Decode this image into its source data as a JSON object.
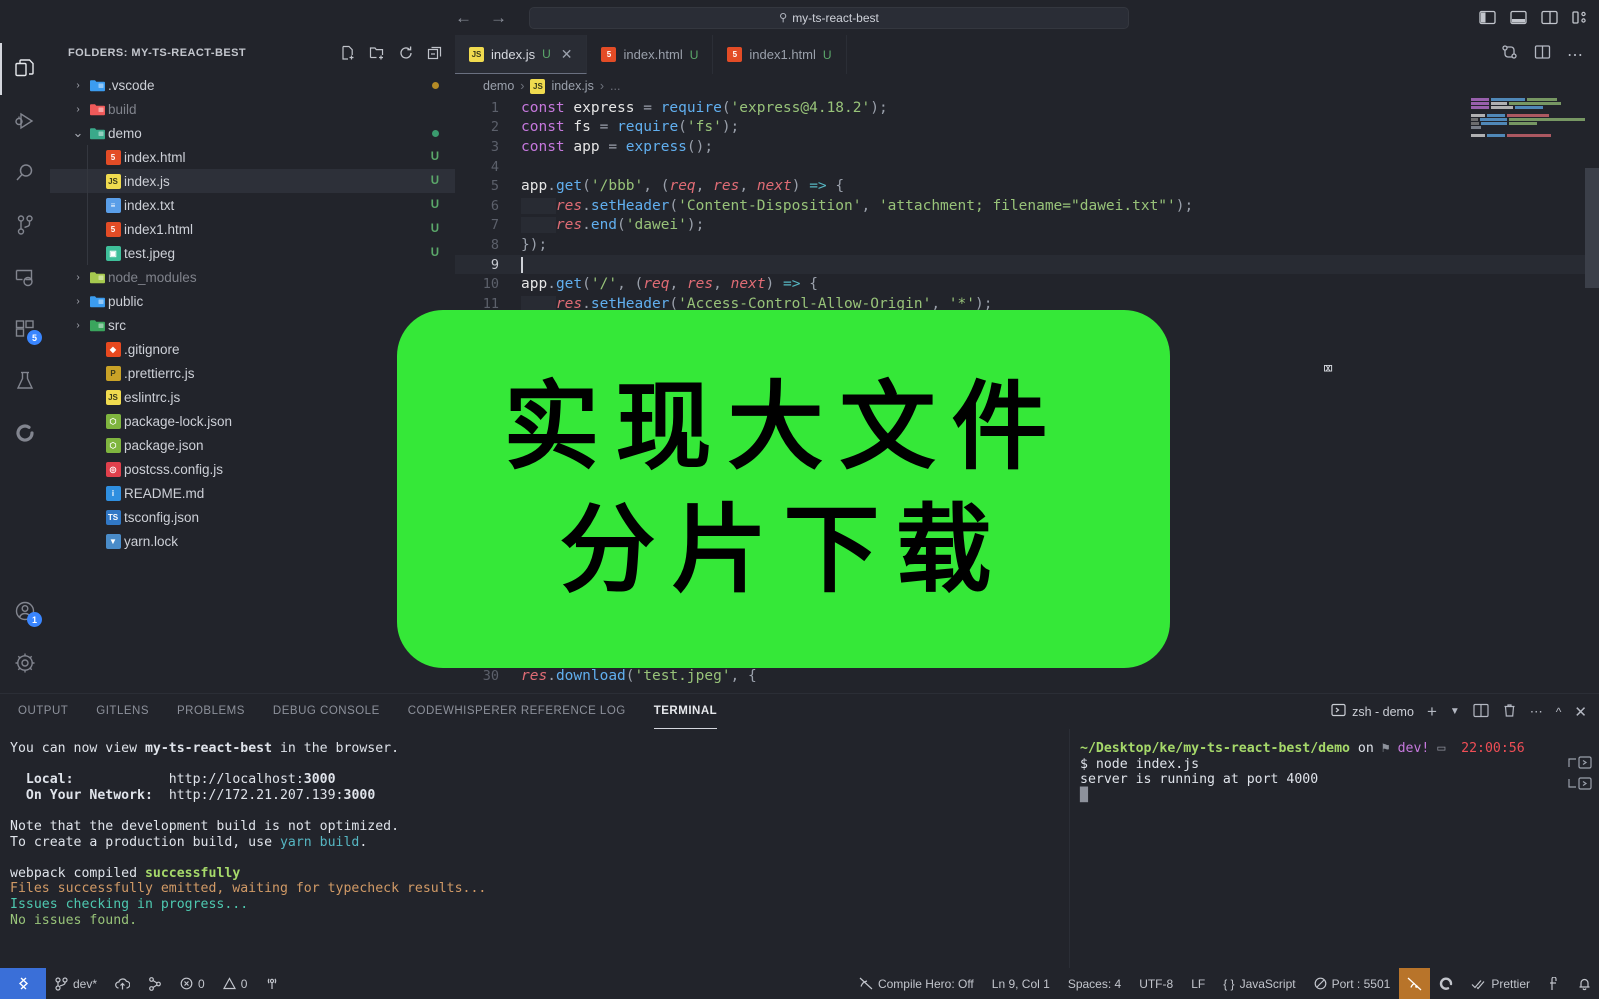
{
  "titlebar": {
    "back_icon": "arrow-left-icon",
    "forward_icon": "arrow-right-icon",
    "search_value": "my-ts-react-best",
    "search_icon": "search-icon",
    "layout_icons": [
      "toggle-primary-sidebar-icon",
      "toggle-panel-icon",
      "toggle-secondary-sidebar-icon",
      "customize-layout-icon"
    ]
  },
  "activitybar": {
    "items": [
      {
        "name": "explorer",
        "icon": "files-icon",
        "active": true
      },
      {
        "name": "run-and-debug",
        "icon": "debug-icon",
        "active": false
      },
      {
        "name": "search",
        "icon": "search-icon",
        "active": false
      },
      {
        "name": "source-control",
        "icon": "source-control-icon",
        "active": false
      },
      {
        "name": "remote-explorer",
        "icon": "remote-explorer-icon",
        "active": false
      },
      {
        "name": "extensions",
        "icon": "extensions-icon",
        "active": false,
        "badge": "5"
      },
      {
        "name": "testing",
        "icon": "beaker-icon",
        "active": false
      },
      {
        "name": "codewhisperer",
        "icon": "codewhisperer-icon",
        "active": false
      }
    ],
    "bottom": [
      {
        "name": "accounts",
        "icon": "account-icon",
        "badge": "1"
      },
      {
        "name": "manage",
        "icon": "gear-icon"
      }
    ]
  },
  "sidebar": {
    "title": "FOLDERS: MY-TS-REACT-BEST",
    "actions": [
      "new-file-icon",
      "new-folder-icon",
      "refresh-icon",
      "collapse-all-icon"
    ],
    "tree": [
      {
        "label": ".vscode",
        "type": "folder",
        "expanded": false,
        "indent": 0,
        "icon_color": "#3b9cf0",
        "badge": "",
        "dot": "#b58b26",
        "dim": false
      },
      {
        "label": "build",
        "type": "folder",
        "expanded": false,
        "indent": 0,
        "icon_color": "#ef5a5a",
        "badge": "",
        "dot": "",
        "dim": true
      },
      {
        "label": "demo",
        "type": "folder",
        "expanded": true,
        "indent": 0,
        "icon_color": "#3aa98a",
        "badge": "",
        "dot": "#3a9b6e",
        "dim": false
      },
      {
        "label": "index.html",
        "type": "html",
        "expanded": false,
        "indent": 1,
        "icon_color": "#e34c26",
        "badge": "U",
        "dot": "",
        "dim": false
      },
      {
        "label": "index.js",
        "type": "js",
        "expanded": false,
        "indent": 1,
        "icon_color": "#f0db4f",
        "badge": "U",
        "dot": "",
        "dim": false,
        "selected": true
      },
      {
        "label": "index.txt",
        "type": "txt",
        "expanded": false,
        "indent": 1,
        "icon_color": "#5a9ee8",
        "badge": "U",
        "dot": "",
        "dim": false
      },
      {
        "label": "index1.html",
        "type": "html",
        "expanded": false,
        "indent": 1,
        "icon_color": "#e34c26",
        "badge": "U",
        "dot": "",
        "dim": false
      },
      {
        "label": "test.jpeg",
        "type": "img",
        "expanded": false,
        "indent": 1,
        "icon_color": "#3fbf9a",
        "badge": "U",
        "dot": "",
        "dim": false
      },
      {
        "label": "node_modules",
        "type": "folder",
        "expanded": false,
        "indent": 0,
        "icon_color": "#a6c94f",
        "badge": "",
        "dot": "",
        "dim": true
      },
      {
        "label": "public",
        "type": "folder",
        "expanded": false,
        "indent": 0,
        "icon_color": "#3b9cf0",
        "badge": "",
        "dot": "",
        "dim": false
      },
      {
        "label": "src",
        "type": "folder",
        "expanded": false,
        "indent": 0,
        "icon_color": "#3aa55d",
        "badge": "",
        "dot": "",
        "dim": false
      },
      {
        "label": ".gitignore",
        "type": "git",
        "expanded": false,
        "indent": 1,
        "icon_color": "#e8491f",
        "badge": "",
        "dot": "",
        "dim": false
      },
      {
        "label": ".prettierrc.js",
        "type": "prettier",
        "expanded": false,
        "indent": 1,
        "icon_color": "#c9a227",
        "badge": "",
        "dot": "",
        "dim": false
      },
      {
        "label": "eslintrc.js",
        "type": "js",
        "expanded": false,
        "indent": 1,
        "icon_color": "#f0db4f",
        "badge": "",
        "dot": "",
        "dim": false
      },
      {
        "label": "package-lock.json",
        "type": "node",
        "expanded": false,
        "indent": 1,
        "icon_color": "#7fb53f",
        "badge": "",
        "dot": "",
        "dim": false
      },
      {
        "label": "package.json",
        "type": "node",
        "expanded": false,
        "indent": 1,
        "icon_color": "#7fb53f",
        "badge": "",
        "dot": "",
        "dim": false
      },
      {
        "label": "postcss.config.js",
        "type": "postcss",
        "expanded": false,
        "indent": 1,
        "icon_color": "#e0404c",
        "badge": "",
        "dot": "",
        "dim": false
      },
      {
        "label": "README.md",
        "type": "info",
        "expanded": false,
        "indent": 1,
        "icon_color": "#2f8fe0",
        "badge": "",
        "dot": "",
        "dim": false
      },
      {
        "label": "tsconfig.json",
        "type": "ts",
        "expanded": false,
        "indent": 1,
        "icon_color": "#3178c6",
        "badge": "",
        "dot": "",
        "dim": false
      },
      {
        "label": "yarn.lock",
        "type": "yarn",
        "expanded": false,
        "indent": 1,
        "icon_color": "#4a8cc9",
        "badge": "",
        "dot": "",
        "dim": false
      }
    ]
  },
  "editor": {
    "tabs": [
      {
        "label": "index.js",
        "icon": "js-file-icon",
        "git": "U",
        "active": true,
        "closable": true
      },
      {
        "label": "index.html",
        "icon": "html-file-icon",
        "git": "U",
        "active": false,
        "closable": false
      },
      {
        "label": "index1.html",
        "icon": "html-file-icon",
        "git": "U",
        "active": false,
        "closable": false
      }
    ],
    "tabs_actions": [
      "split-diff-icon",
      "split-editor-icon",
      "more-actions-icon"
    ],
    "breadcrumb": [
      "demo",
      "index.js",
      "..."
    ],
    "lines": [
      {
        "n": "1",
        "tokens": [
          [
            "t-kw",
            "const"
          ],
          [
            "t-pun",
            " "
          ],
          [
            "t-var",
            "express"
          ],
          [
            "t-pun",
            " = "
          ],
          [
            "t-fn",
            "require"
          ],
          [
            "t-pun",
            "("
          ],
          [
            "t-str",
            "'express@4.18.2'"
          ],
          [
            "t-pun",
            ");"
          ]
        ]
      },
      {
        "n": "2",
        "tokens": [
          [
            "t-kw",
            "const"
          ],
          [
            "t-pun",
            " "
          ],
          [
            "t-var",
            "fs"
          ],
          [
            "t-pun",
            " = "
          ],
          [
            "t-fn",
            "require"
          ],
          [
            "t-pun",
            "("
          ],
          [
            "t-str",
            "'fs'"
          ],
          [
            "t-pun",
            ");"
          ]
        ]
      },
      {
        "n": "3",
        "tokens": [
          [
            "t-kw",
            "const"
          ],
          [
            "t-pun",
            " "
          ],
          [
            "t-var",
            "app"
          ],
          [
            "t-pun",
            " = "
          ],
          [
            "t-fn",
            "express"
          ],
          [
            "t-pun",
            "();"
          ]
        ]
      },
      {
        "n": "4",
        "tokens": []
      },
      {
        "n": "5",
        "tokens": [
          [
            "t-var",
            "app"
          ],
          [
            "t-pun",
            "."
          ],
          [
            "t-fn",
            "get"
          ],
          [
            "t-pun",
            "("
          ],
          [
            "t-str",
            "'/bbb'"
          ],
          [
            "t-pun",
            ", ("
          ],
          [
            "t-par",
            "req"
          ],
          [
            "t-pun",
            ", "
          ],
          [
            "t-par",
            "res"
          ],
          [
            "t-pun",
            ", "
          ],
          [
            "t-par",
            "next"
          ],
          [
            "t-pun",
            ") "
          ],
          [
            "t-op",
            "=>"
          ],
          [
            "t-pun",
            " {"
          ]
        ]
      },
      {
        "n": "6",
        "indent": true,
        "tokens": [
          [
            "t-par",
            "res"
          ],
          [
            "t-pun",
            "."
          ],
          [
            "t-fn",
            "setHeader"
          ],
          [
            "t-pun",
            "("
          ],
          [
            "t-str",
            "'Content-Disposition'"
          ],
          [
            "t-pun",
            ", "
          ],
          [
            "t-str",
            "'attachment; filename=\"dawei.txt\"'"
          ],
          [
            "t-pun",
            ");"
          ]
        ]
      },
      {
        "n": "7",
        "indent": true,
        "tokens": [
          [
            "t-par",
            "res"
          ],
          [
            "t-pun",
            "."
          ],
          [
            "t-fn",
            "end"
          ],
          [
            "t-pun",
            "("
          ],
          [
            "t-str",
            "'dawei'"
          ],
          [
            "t-pun",
            ");"
          ]
        ]
      },
      {
        "n": "8",
        "tokens": [
          [
            "t-pun",
            "});"
          ]
        ]
      },
      {
        "n": "9",
        "current": true,
        "caret": true,
        "tokens": []
      },
      {
        "n": "10",
        "tokens": [
          [
            "t-var",
            "app"
          ],
          [
            "t-pun",
            "."
          ],
          [
            "t-fn",
            "get"
          ],
          [
            "t-pun",
            "("
          ],
          [
            "t-str",
            "'/'"
          ],
          [
            "t-pun",
            ", ("
          ],
          [
            "t-par",
            "req"
          ],
          [
            "t-pun",
            ", "
          ],
          [
            "t-par",
            "res"
          ],
          [
            "t-pun",
            ", "
          ],
          [
            "t-par",
            "next"
          ],
          [
            "t-pun",
            ") "
          ],
          [
            "t-op",
            "=>"
          ],
          [
            "t-pun",
            " {"
          ]
        ]
      },
      {
        "n": "11",
        "indent": true,
        "tokens": [
          [
            "t-par",
            "res"
          ],
          [
            "t-pun",
            "."
          ],
          [
            "t-fn",
            "setHeader"
          ],
          [
            "t-pun",
            "("
          ],
          [
            "t-str",
            "'Access-Control-Allow-Origin'"
          ],
          [
            "t-pun",
            ", "
          ],
          [
            "t-str",
            "'*'"
          ],
          [
            "t-pun",
            ");"
          ]
        ]
      }
    ],
    "obscured_line": {
      "n": "30",
      "tokens": [
        [
          "t-par",
          "res"
        ],
        [
          "t-pun",
          "."
        ],
        [
          "t-fn",
          "download"
        ],
        [
          "t-pun",
          "("
        ],
        [
          "t-str",
          "'test.jpeg'"
        ],
        [
          "t-pun",
          ", {"
        ]
      ]
    },
    "mouse_cursor_icon": "text-ibeam-cursor"
  },
  "overlay": {
    "line1": "实现大文件",
    "line2": "分片下载",
    "background_color": "#35e838",
    "text_color": "#000000"
  },
  "panel": {
    "tabs": [
      {
        "label": "OUTPUT",
        "active": false
      },
      {
        "label": "GITLENS",
        "active": false
      },
      {
        "label": "PROBLEMS",
        "active": false
      },
      {
        "label": "DEBUG CONSOLE",
        "active": false
      },
      {
        "label": "CODEWHISPERER REFERENCE LOG",
        "active": false
      },
      {
        "label": "TERMINAL",
        "active": true
      }
    ],
    "terminal_selector": "zsh - demo",
    "terminal_selector_icon": "terminal-icon",
    "actions": [
      "new-terminal-icon",
      "terminal-dropdown-icon",
      "split-terminal-icon",
      "kill-terminal-icon",
      "panel-more-icon",
      "maximize-panel-icon",
      "close-panel-icon"
    ],
    "left_terminal": [
      {
        "segments": [
          [
            "c-white",
            "You can now view "
          ],
          [
            "c-white bd",
            "my-ts-react-best"
          ],
          [
            "c-white",
            " in the browser."
          ]
        ]
      },
      {
        "segments": []
      },
      {
        "segments": [
          [
            "c-white",
            "  "
          ],
          [
            "c-white bd",
            "Local:"
          ],
          [
            "c-white",
            "            http://localhost:"
          ],
          [
            "c-white bd",
            "3000"
          ]
        ]
      },
      {
        "segments": [
          [
            "c-white",
            "  "
          ],
          [
            "c-white bd",
            "On Your Network:"
          ],
          [
            "c-white",
            "  http://172.21.207.139:"
          ],
          [
            "c-white bd",
            "3000"
          ]
        ]
      },
      {
        "segments": []
      },
      {
        "segments": [
          [
            "c-white",
            "Note that the development build is not optimized."
          ]
        ]
      },
      {
        "segments": [
          [
            "c-white",
            "To create a production build, use "
          ],
          [
            "c-cyan",
            "yarn build"
          ],
          [
            "c-white",
            "."
          ]
        ]
      },
      {
        "segments": []
      },
      {
        "segments": [
          [
            "c-white",
            "webpack compiled "
          ],
          [
            "c-lgreen bd",
            "successfully"
          ]
        ]
      },
      {
        "segments": [
          [
            "c-orange",
            "Files successfully emitted, waiting for typecheck results..."
          ]
        ]
      },
      {
        "segments": [
          [
            "c-teal",
            "Issues checking in progress..."
          ]
        ]
      },
      {
        "segments": [
          [
            "c-green",
            "No issues found."
          ]
        ]
      }
    ],
    "right_terminal": [
      {
        "segments": [
          [
            "c-lgreen bd",
            "~/Desktop/ke/my-ts-react-best/demo"
          ],
          [
            "c-white",
            " on "
          ],
          [
            "c-gray",
            "⚑"
          ],
          [
            "c-magenta",
            " dev!"
          ],
          [
            "c-gray",
            " ▭"
          ],
          [
            "c-red",
            "  22:00:56"
          ]
        ]
      },
      {
        "segments": [
          [
            "c-white",
            "$ node index.js"
          ]
        ]
      },
      {
        "segments": [
          [
            "c-white",
            "server is running at port 4000"
          ]
        ]
      },
      {
        "segments": [
          [
            "c-gray",
            "█"
          ]
        ]
      }
    ],
    "side_buttons": [
      "scroll-to-previous-command-icon",
      "scroll-to-next-command-icon"
    ]
  },
  "statusbar": {
    "remote_icon": "remote-window-icon",
    "left": [
      {
        "name": "branch",
        "icon": "source-control-icon",
        "label": "dev*"
      },
      {
        "name": "sync",
        "icon": "cloud-upload-icon",
        "label": ""
      },
      {
        "name": "gitlens-blame",
        "icon": "gitlens-icon",
        "label": ""
      },
      {
        "name": "errors",
        "icon": "error-icon",
        "label": "0"
      },
      {
        "name": "warnings",
        "icon": "warning-icon",
        "label": "0"
      },
      {
        "name": "ports",
        "icon": "radio-tower-icon",
        "label": ""
      }
    ],
    "right": [
      {
        "name": "compile-hero",
        "icon": "compile-hero-icon",
        "label": "Compile Hero: Off"
      },
      {
        "name": "cursor-position",
        "icon": "",
        "label": "Ln 9, Col 1"
      },
      {
        "name": "indentation",
        "icon": "",
        "label": "Spaces: 4"
      },
      {
        "name": "encoding",
        "icon": "",
        "label": "UTF-8"
      },
      {
        "name": "eol",
        "icon": "",
        "label": "LF"
      },
      {
        "name": "language-mode",
        "icon": "braces-icon",
        "label": "JavaScript"
      },
      {
        "name": "live-server-port",
        "icon": "circle-slash-icon",
        "label": "Port : 5501"
      },
      {
        "name": "screencast-mode",
        "icon": "screencast-off-icon",
        "label": "",
        "highlight": true
      },
      {
        "name": "codewhisperer-status",
        "icon": "codewhisperer-icon",
        "label": ""
      },
      {
        "name": "prettier",
        "icon": "check-icon",
        "label": "Prettier"
      },
      {
        "name": "keyboard-shortcuts",
        "icon": "keyboard-icon",
        "label": ""
      },
      {
        "name": "notifications",
        "icon": "bell-icon",
        "label": ""
      }
    ]
  }
}
